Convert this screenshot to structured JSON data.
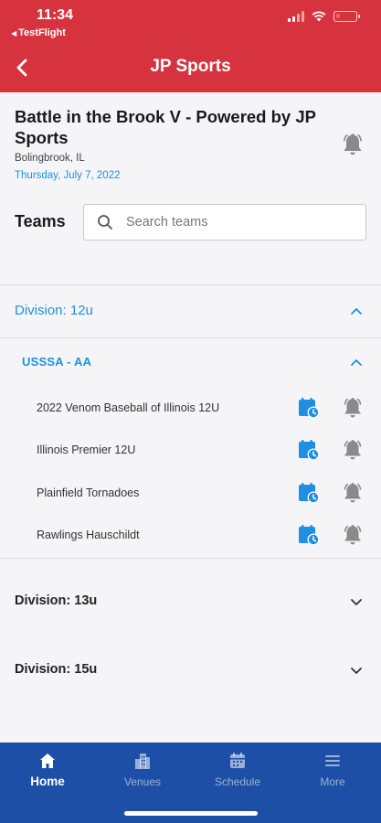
{
  "status_bar": {
    "time": "11:34",
    "back_app": "TestFlight"
  },
  "header": {
    "title": "JP Sports"
  },
  "event": {
    "title": "Battle in the Brook V - Powered by JP Sports",
    "location": "Bolingbrook, IL",
    "date": "Thursday, July 7, 2022"
  },
  "search": {
    "label": "Teams",
    "placeholder": "Search teams"
  },
  "divisions": [
    {
      "label": "Division: 12u",
      "expanded": true,
      "subdivision": {
        "label": "USSSA - AA",
        "teams": [
          {
            "name": "2022 Venom Baseball of Illinois 12U"
          },
          {
            "name": "Illinois Premier 12U"
          },
          {
            "name": "Plainfield Tornadoes"
          },
          {
            "name": "Rawlings Hauschildt"
          }
        ]
      }
    },
    {
      "label": "Division: 13u",
      "expanded": false
    },
    {
      "label": "Division: 15u",
      "expanded": false
    }
  ],
  "bottom_nav": {
    "items": [
      {
        "label": "Home",
        "icon": "home-icon",
        "active": true
      },
      {
        "label": "Venues",
        "icon": "buildings-icon",
        "active": false
      },
      {
        "label": "Schedule",
        "icon": "calendar-icon",
        "active": false
      },
      {
        "label": "More",
        "icon": "menu-icon",
        "active": false
      }
    ]
  },
  "colors": {
    "header_red": "#d6333f",
    "accent_blue": "#1e8fe1",
    "nav_blue": "#1e4fa6",
    "bell_gray": "#8a8a8a"
  }
}
